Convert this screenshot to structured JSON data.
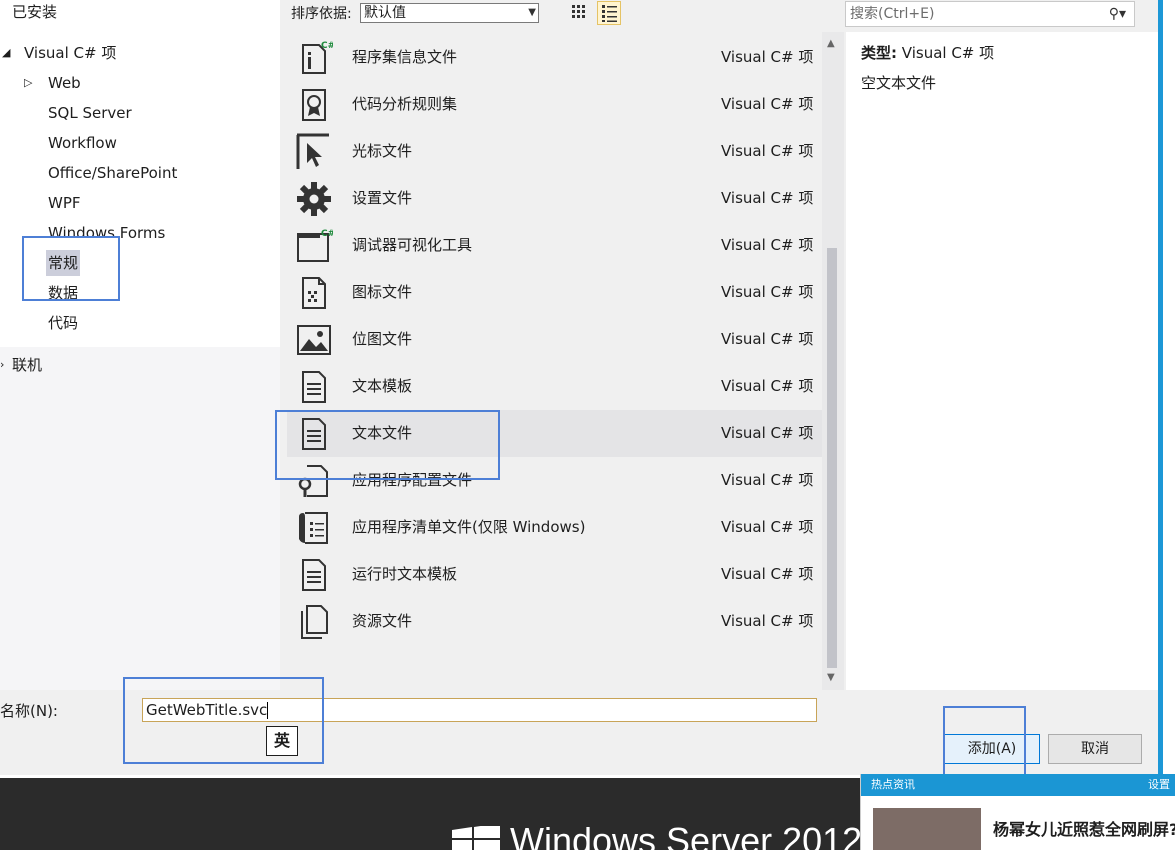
{
  "tree": {
    "installed": "已安装",
    "visual_csharp": "Visual C# 项",
    "children": [
      "Web",
      "SQL Server",
      "Workflow",
      "Office/SharePoint",
      "WPF",
      "Windows Forms",
      "常规",
      "数据",
      "代码"
    ],
    "online": "联机"
  },
  "toolbar": {
    "sort_label": "排序依据:",
    "sort_value": "默认值",
    "search_placeholder": "搜索(Ctrl+E)"
  },
  "items": [
    {
      "name": "程序集信息文件",
      "type": "Visual C# 项",
      "icon": "assembly-info-icon"
    },
    {
      "name": "代码分析规则集",
      "type": "Visual C# 项",
      "icon": "ruleset-icon"
    },
    {
      "name": "光标文件",
      "type": "Visual C# 项",
      "icon": "cursor-icon"
    },
    {
      "name": "设置文件",
      "type": "Visual C# 项",
      "icon": "gear-icon"
    },
    {
      "name": "调试器可视化工具",
      "type": "Visual C# 项",
      "icon": "visualizer-icon"
    },
    {
      "name": "图标文件",
      "type": "Visual C# 项",
      "icon": "icon-file-icon"
    },
    {
      "name": "位图文件",
      "type": "Visual C# 项",
      "icon": "bitmap-icon"
    },
    {
      "name": "文本模板",
      "type": "Visual C# 项",
      "icon": "text-template-icon"
    },
    {
      "name": "文本文件",
      "type": "Visual C# 项",
      "icon": "text-file-icon"
    },
    {
      "name": "应用程序配置文件",
      "type": "Visual C# 项",
      "icon": "config-file-icon"
    },
    {
      "name": "应用程序清单文件(仅限 Windows)",
      "type": "Visual C# 项",
      "icon": "manifest-icon"
    },
    {
      "name": "运行时文本模板",
      "type": "Visual C# 项",
      "icon": "runtime-template-icon"
    },
    {
      "name": "资源文件",
      "type": "Visual C# 项",
      "icon": "resource-file-icon"
    }
  ],
  "info": {
    "type_label": "类型:",
    "type_value": "Visual C# 项",
    "description": "空文本文件"
  },
  "name_field": {
    "label": "名称(N):",
    "value": "GetWebTitle.svc",
    "ime": "英"
  },
  "buttons": {
    "add": "添加(A)",
    "cancel": "取消"
  },
  "desktop": {
    "os_text": "Windows Server 2012"
  },
  "news": {
    "header_left": "热点资讯",
    "header_right": "设置",
    "headline": "杨幂女儿近照惹全网刷屏?"
  },
  "colors": {
    "highlight_box": "#4d7fd6",
    "window_accent": "#1c97d6",
    "selected_tree": "#cccedb"
  }
}
